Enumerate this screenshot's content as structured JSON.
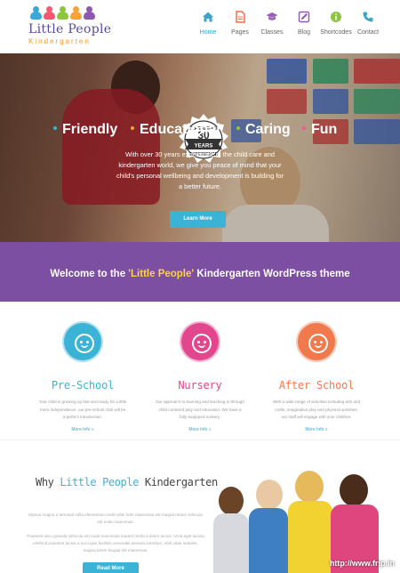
{
  "logo": {
    "title": "Little People",
    "subtitle": "Kindergarten",
    "figure_colors": [
      "#3aa9d8",
      "#f25a6f",
      "#8cc63f",
      "#f7a23b",
      "#8e59b4"
    ]
  },
  "nav": {
    "items": [
      {
        "label": "Home",
        "icon": "home-icon",
        "active": true,
        "color": "#3ba4c9"
      },
      {
        "label": "Pages",
        "icon": "document-icon",
        "active": false,
        "color": "#f36b4b"
      },
      {
        "label": "Classes",
        "icon": "graduation-cap-icon",
        "active": false,
        "color": "#9a5fb8"
      },
      {
        "label": "Blog",
        "icon": "pencil-icon",
        "active": false,
        "color": "#8e59b4"
      },
      {
        "label": "Shortcodes",
        "icon": "info-icon",
        "active": false,
        "color": "#8cc63f"
      },
      {
        "label": "Contact",
        "icon": "phone-icon",
        "active": false,
        "color": "#3ba4c9"
      }
    ]
  },
  "hero": {
    "badge": {
      "top": "EXPERIENCE",
      "number": "30",
      "unit": "YEARS",
      "bottom": "EXPERIENCE"
    },
    "words": [
      {
        "text": "Friendly",
        "dot_color": "#3bb3d6"
      },
      {
        "text": "Educational",
        "dot_color": "#f7a23b"
      },
      {
        "text": "Caring",
        "dot_color": "#8cc63f"
      },
      {
        "text": "Fun",
        "dot_color": "#f25a9a"
      }
    ],
    "text": "With over 30 years experience in the child care and kindergarten world, we give you peace of mind that your child's personal wellbeing and development is building for a better future.",
    "button_label": "Learn More"
  },
  "welcome": {
    "prefix": "Welcome to the ",
    "highlight": "'Little People'",
    "suffix": " Kindergarten WordPress theme"
  },
  "programs": [
    {
      "title": "Pre-School",
      "color": "#3bb3d6",
      "icon": "boy-face-icon",
      "desc": "Your child is growing up fast and ready for a little more independence, our pre-school club will be a perfect introduction.",
      "more": "More Info »"
    },
    {
      "title": "Nursery",
      "color": "#e2468c",
      "icon": "baby-face-icon",
      "desc": "Our approach to learning and teaching is through child centered play and education. We have a fully equipped nursery.",
      "more": "More Info »"
    },
    {
      "title": "After School",
      "color": "#f17a4d",
      "icon": "girl-face-icon",
      "desc": "With a wide range of activities including arts and crafts, imaginative play and physical activities, our staff will engage with your children.",
      "more": "More Info »"
    }
  ],
  "why": {
    "prefix": "Why ",
    "highlight": "Little People",
    "suffix": " Kindergarten",
    "paragraphs": [
      "Dipsos magna a terminal nulla elementum morbi elite forte maecenas est magna metus vehicula est node maecenas.",
      "Praesent arcu gravida vehicula est node maecenas loareet morbi a dosor luctus. Urna eget lacinia eleifend praesent luctus a arcu quis facilisis venenatis aenean interdum, nibh vitae sodales, magna lorem feugiat elit maecenas."
    ],
    "button_label": "Read More"
  },
  "watermark": "http://www.frip.in"
}
